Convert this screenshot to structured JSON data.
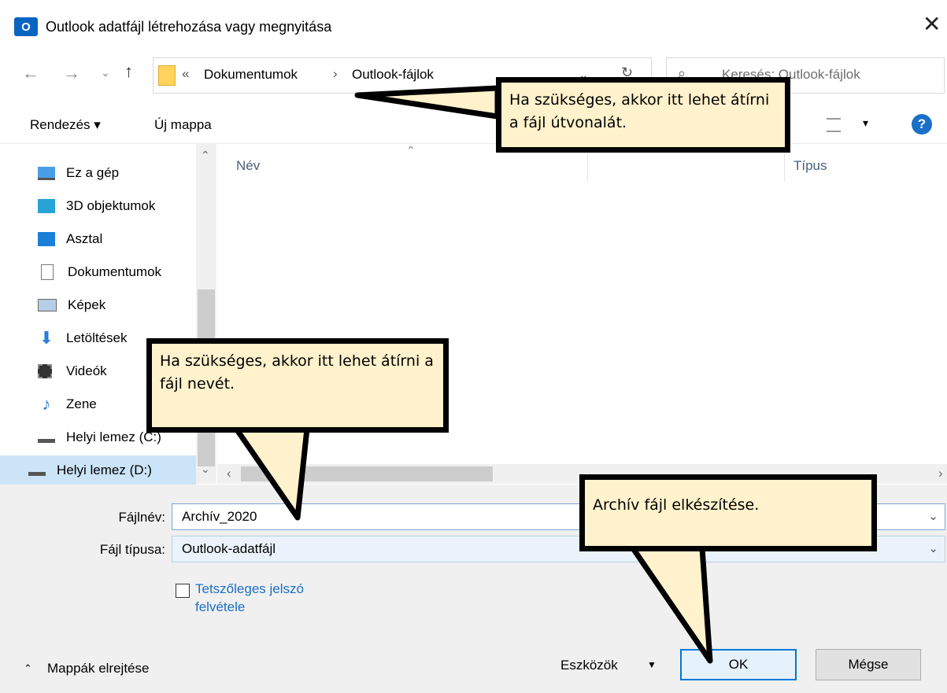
{
  "title": "Outlook adatfájl létrehozása vagy megnyitása",
  "app_icon_text": "O",
  "path": {
    "prefix": "«",
    "segments": [
      "Dokumentumok",
      "Outlook-fájlok"
    ],
    "separator": "›"
  },
  "search": {
    "placeholder": "Keresés: Outlook-fájlok"
  },
  "toolbar": {
    "organize": "Rendezés ▾",
    "new_folder": "Új mappa",
    "view": "▾",
    "help": "?"
  },
  "columns": {
    "name": "Név",
    "type": "Típus"
  },
  "nav_items": [
    {
      "label": "Ez a gép",
      "icon": "computer-icon"
    },
    {
      "label": "3D objektumok",
      "icon": "cube-icon"
    },
    {
      "label": "Asztal",
      "icon": "desktop-icon"
    },
    {
      "label": "Dokumentumok",
      "icon": "document-icon"
    },
    {
      "label": "Képek",
      "icon": "pictures-icon"
    },
    {
      "label": "Letöltések",
      "icon": "download-icon"
    },
    {
      "label": "Videók",
      "icon": "video-icon"
    },
    {
      "label": "Zene",
      "icon": "music-icon"
    },
    {
      "label": "Helyi lemez (C:)",
      "icon": "drive-icon"
    },
    {
      "label": "Helyi lemez (D:)",
      "icon": "drive-icon"
    }
  ],
  "filename": {
    "label": "Fájlnév:",
    "value": "Archív_2020"
  },
  "filetype": {
    "label": "Fájl típusa:",
    "value": "Outlook-adatfájl"
  },
  "password_checkbox": {
    "line1": "Tetszőleges jelszó",
    "line2": "felvétele",
    "checked": false
  },
  "hide_folders": "Mappák elrejtése",
  "tools": "Eszközök",
  "ok": "OK",
  "cancel": "Mégse",
  "callouts": {
    "path": "Ha szükséges, akkor itt lehet átírni a fájl útvonalát.",
    "name": "Ha szükséges, akkor itt lehet átírni a fájl nevét.",
    "ok": "Archív fájl elkészítése."
  }
}
